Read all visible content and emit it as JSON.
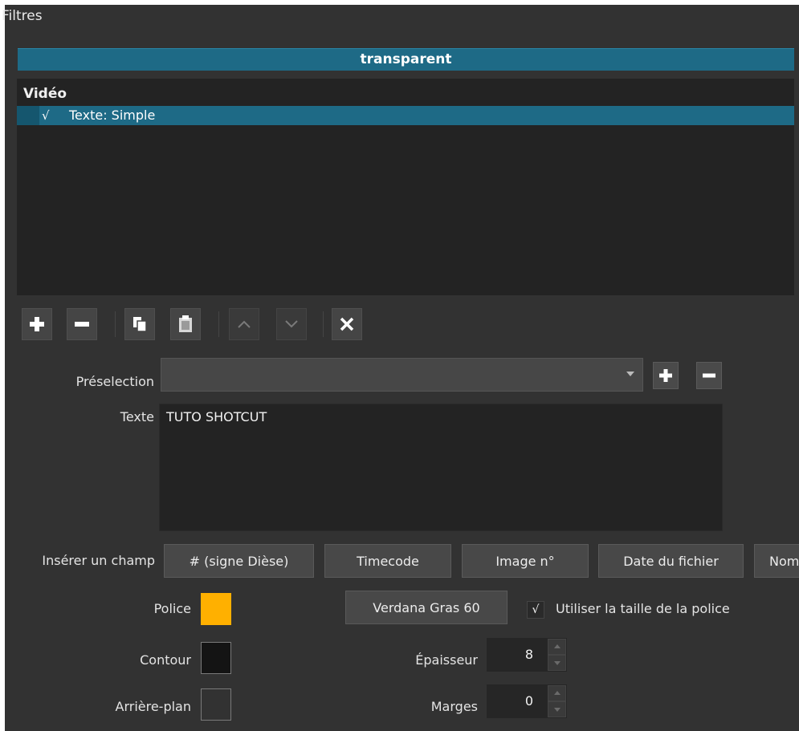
{
  "panel": {
    "title": "Filtres"
  },
  "clip": {
    "name": "transparent"
  },
  "filter_list": {
    "category": "Vidéo",
    "items": [
      {
        "checked": "√",
        "label": "Texte: Simple",
        "selected": true
      }
    ]
  },
  "toolbar": {
    "icons": [
      "add-icon",
      "remove-icon",
      "copy-icon",
      "paste-icon",
      "move-up-icon",
      "move-down-icon",
      "deselect-icon"
    ]
  },
  "preset": {
    "label": "Préselection",
    "value": ""
  },
  "text": {
    "label": "Texte",
    "value": "TUTO SHOTCUT"
  },
  "insert_field": {
    "label": "Insérer un champ",
    "buttons": [
      "# (signe Dièse)",
      "Timecode",
      "Image n°",
      "Date du fichier",
      "Nom"
    ]
  },
  "font": {
    "label": "Police",
    "color": "#ffb000",
    "font_button": "Verdana Gras 60",
    "use_font_size_check": "√",
    "use_font_size_label": "Utiliser la taille de la police"
  },
  "outline": {
    "label": "Contour",
    "color": "#141414",
    "thickness_label": "Épaisseur",
    "thickness": "8"
  },
  "background": {
    "label": "Arrière-plan",
    "color": "#323232",
    "margins_label": "Marges",
    "margins": "0"
  },
  "colors": {
    "accent": "#1e6a86",
    "panel": "#323232",
    "field": "#232323"
  }
}
